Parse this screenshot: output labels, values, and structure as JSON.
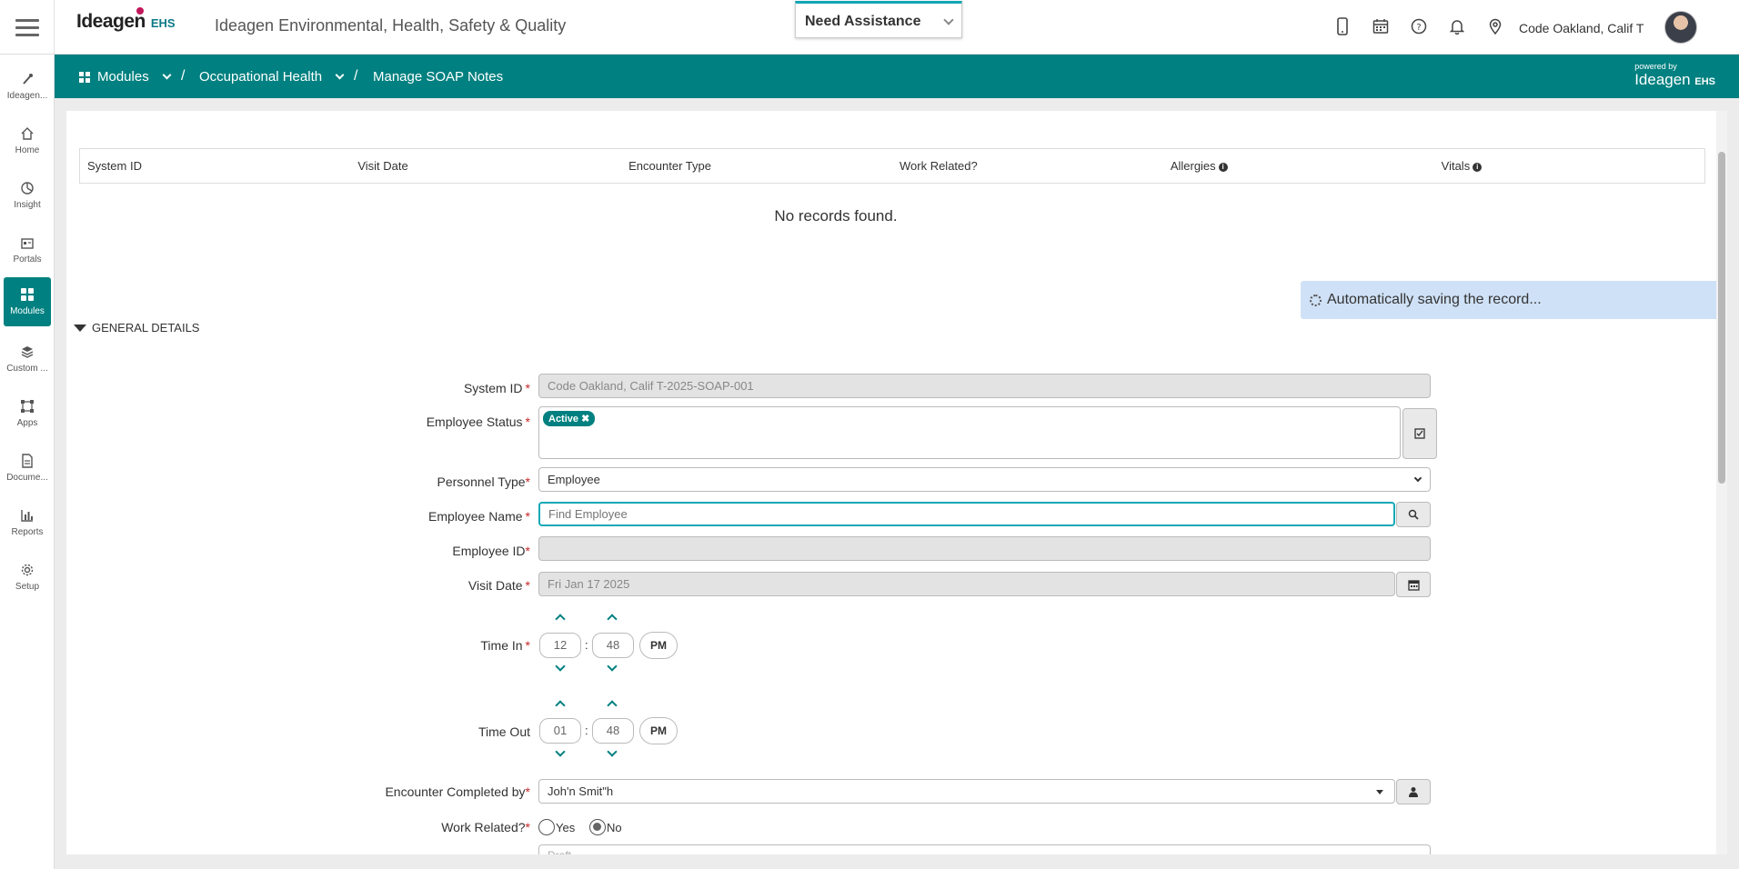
{
  "header": {
    "logo_brand": "Ideagen",
    "logo_suffix": "EHS",
    "app_title": "Ideagen Environmental, Health, Safety & Quality",
    "assistance_label": "Need Assistance",
    "user_name": "Code Oakland, Calif T",
    "icons": [
      "mobile-icon",
      "calendar-icon",
      "help-icon",
      "bell-icon",
      "location-pin-icon"
    ]
  },
  "breadcrumb": {
    "items": [
      "Modules",
      "Occupational Health",
      "Manage SOAP Notes"
    ],
    "separator": "/",
    "powered_by_small": "powered by",
    "powered_by_brand": "Ideagen",
    "powered_by_suffix": "EHS"
  },
  "sidebar": {
    "items": [
      {
        "label": "Ideagen...",
        "icon": "ideagen-icon"
      },
      {
        "label": "Home",
        "icon": "home-icon"
      },
      {
        "label": "Insight",
        "icon": "pie-chart-icon"
      },
      {
        "label": "Portals",
        "icon": "portal-icon"
      },
      {
        "label": "Modules",
        "icon": "grid-icon",
        "active": true
      },
      {
        "label": "Custom ...",
        "icon": "layers-icon"
      },
      {
        "label": "Apps",
        "icon": "apps-icon"
      },
      {
        "label": "Docume...",
        "icon": "document-icon"
      },
      {
        "label": "Reports",
        "icon": "bar-chart-icon"
      },
      {
        "label": "Setup",
        "icon": "gear-icon"
      }
    ]
  },
  "records_table": {
    "columns": [
      "System ID",
      "Visit Date",
      "Encounter Type",
      "Work Related?",
      "Allergies",
      "Vitals"
    ],
    "empty_message": "No records found."
  },
  "autosave_message": "Automatically saving the record...",
  "section_title": "GENERAL DETAILS",
  "form": {
    "system_id": {
      "label": "System ID",
      "value": "Code Oakland, Calif T-2025-SOAP-001"
    },
    "employee_status": {
      "label": "Employee Status",
      "tag": "Active"
    },
    "personnel_type": {
      "label": "Personnel Type",
      "value": "Employee"
    },
    "employee_name": {
      "label": "Employee Name",
      "placeholder": "Find Employee"
    },
    "employee_id": {
      "label": "Employee ID",
      "value": ""
    },
    "visit_date": {
      "label": "Visit Date",
      "value": "Fri Jan 17 2025"
    },
    "time_in": {
      "label": "Time In",
      "hour": "12",
      "minute": "48",
      "ampm": "PM"
    },
    "time_out": {
      "label": "Time Out",
      "hour": "01",
      "minute": "48",
      "ampm": "PM"
    },
    "encounter_completed_by": {
      "label": "Encounter Completed by",
      "value": "Joh'n Smit\"h"
    },
    "work_related": {
      "label": "Work Related?",
      "options": [
        "Yes",
        "No"
      ],
      "selected": "No"
    },
    "partial_field_text": "Draft"
  }
}
